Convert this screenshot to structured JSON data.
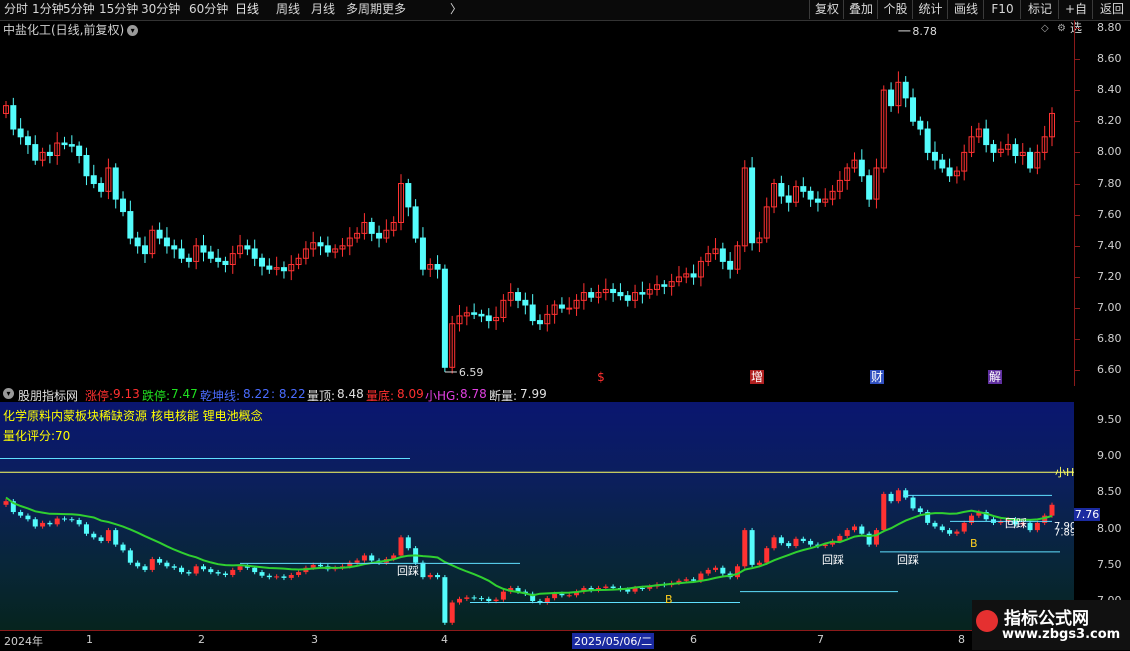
{
  "toolbar": {
    "periods": [
      "分时",
      "1分钟",
      "5分钟",
      "15分钟",
      "30分钟",
      "60分钟",
      "日线",
      "周线",
      "月线",
      "多周期",
      "更多"
    ],
    "more_arrow": "〉",
    "buttons": [
      "复权",
      "叠加",
      "个股",
      "统计",
      "画线",
      "F10",
      "+自选",
      "返回"
    ],
    "marker_button": "标记"
  },
  "stock": {
    "title": "中盐化工(日线,前复权)",
    "high_label": "8.78",
    "low_label": "6.59"
  },
  "main_axis": {
    "ticks": [
      "8.80",
      "8.60",
      "8.40",
      "8.20",
      "8.00",
      "7.80",
      "7.60",
      "7.40",
      "7.20",
      "7.00",
      "6.80",
      "6.60"
    ]
  },
  "event_markers": [
    "$",
    "增",
    "财",
    "解"
  ],
  "indicator": {
    "name": "股朋指标网",
    "zt_label": "涨停:",
    "zt_value": "9.13",
    "dt_label": "跌停:",
    "dt_value": "7.47",
    "qk_label": "乾坤线:",
    "qk_value": "8.22",
    "qk_value2": ": 8.22",
    "ld_label": "量顶:",
    "ld_value": "8.48",
    "ldi_label": "量底:",
    "ldi_value": "8.09",
    "hg_label": "小HG:",
    "hg_value": "8.78",
    "dl_label": "断量:",
    "dl_value": "7.99",
    "concepts": "化学原料内蒙板块稀缺资源 核电核能 锂电池概念",
    "score": "量化评分:70",
    "tag_hc": "回踩",
    "tag_b": "B",
    "tag_xhg": "小H",
    "price_tag": "7.76",
    "side_vals": [
      "7.90",
      "7.89"
    ]
  },
  "sub_axis": {
    "ticks": [
      "9.50",
      "9.00",
      "8.50",
      "8.00",
      "7.50",
      "7.00"
    ]
  },
  "time_axis": {
    "labels": [
      "2024年",
      "1",
      "2",
      "3",
      "4",
      "2025/05/06/二",
      "6",
      "7",
      "8"
    ]
  },
  "watermark": {
    "title": "指标公式网",
    "url": "www.zbgs3.com"
  },
  "chart_data": {
    "type": "candlestick",
    "title": "中盐化工(日线,前复权)",
    "ylim": [
      6.5,
      8.85
    ],
    "annotations": [
      {
        "label": "8.78",
        "kind": "high"
      },
      {
        "label": "6.59",
        "kind": "low"
      }
    ],
    "closes": [
      8.3,
      8.15,
      8.1,
      8.05,
      7.95,
      8.0,
      7.98,
      8.06,
      8.05,
      8.04,
      7.98,
      7.85,
      7.8,
      7.75,
      7.9,
      7.7,
      7.62,
      7.45,
      7.4,
      7.35,
      7.5,
      7.45,
      7.4,
      7.38,
      7.32,
      7.3,
      7.4,
      7.36,
      7.32,
      7.3,
      7.28,
      7.35,
      7.4,
      7.38,
      7.32,
      7.27,
      7.25,
      7.26,
      7.24,
      7.28,
      7.32,
      7.38,
      7.42,
      7.4,
      7.36,
      7.38,
      7.4,
      7.45,
      7.48,
      7.55,
      7.48,
      7.45,
      7.5,
      7.55,
      7.8,
      7.65,
      7.45,
      7.25,
      7.28,
      7.25,
      6.62,
      6.9,
      6.95,
      6.97,
      6.96,
      6.95,
      6.92,
      6.94,
      7.05,
      7.1,
      7.05,
      7.02,
      6.92,
      6.9,
      6.96,
      7.02,
      7.0,
      7.0,
      7.05,
      7.1,
      7.07,
      7.1,
      7.12,
      7.1,
      7.08,
      7.05,
      7.1,
      7.09,
      7.12,
      7.15,
      7.14,
      7.17,
      7.2,
      7.22,
      7.2,
      7.3,
      7.35,
      7.38,
      7.3,
      7.25,
      7.4,
      7.9,
      7.42,
      7.45,
      7.65,
      7.8,
      7.72,
      7.68,
      7.78,
      7.75,
      7.7,
      7.68,
      7.7,
      7.75,
      7.82,
      7.9,
      7.95,
      7.85,
      7.7,
      7.9,
      8.4,
      8.3,
      8.45,
      8.35,
      8.2,
      8.15,
      8.0,
      7.95,
      7.9,
      7.85,
      7.88,
      8.0,
      8.1,
      8.15,
      8.05,
      8.0,
      8.02,
      8.05,
      7.98,
      8.0,
      7.9,
      8.0,
      8.1,
      8.25
    ]
  }
}
